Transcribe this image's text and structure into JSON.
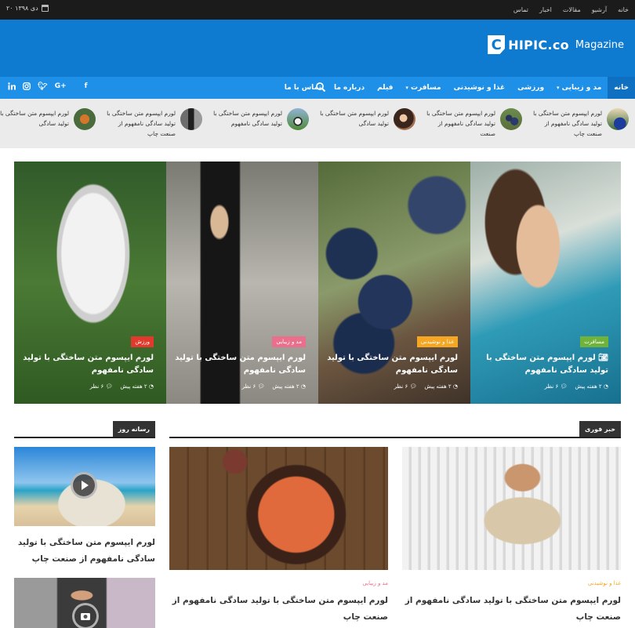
{
  "topbar": {
    "nav": [
      "خانه",
      "آرشیو",
      "مقالات",
      "اخبار",
      "تماس"
    ],
    "date": "۲۰ دی ۱۳۹۸"
  },
  "header": {
    "logo_letter": "C",
    "logo_word": "HIPIC.co",
    "logo_sub": "Magazine"
  },
  "menu": {
    "items": [
      {
        "label": "خانه",
        "active": true,
        "dropdown": false
      },
      {
        "label": "مد و زیبایی",
        "active": false,
        "dropdown": true
      },
      {
        "label": "ورزشی",
        "active": false,
        "dropdown": false
      },
      {
        "label": "غذا و نوشیدنی",
        "active": false,
        "dropdown": false
      },
      {
        "label": "مسافرت",
        "active": false,
        "dropdown": true
      },
      {
        "label": "فیلم",
        "active": false,
        "dropdown": false
      },
      {
        "label": "درباره ما",
        "active": false,
        "dropdown": false
      },
      {
        "label": "تماس با ما",
        "active": false,
        "dropdown": false
      }
    ],
    "dropdown_arrow": "▾",
    "social": [
      "f",
      "t",
      "G+",
      "ig",
      "in"
    ],
    "search_icon": "search-icon"
  },
  "ticker": [
    {
      "title": "لورم ایپسوم متن ساختگی با تولید سادگی نامفهوم از صنعت چاپ"
    },
    {
      "title": "لورم ایپسوم متن ساختگی با تولید سادگی نامفهوم از صنعت"
    },
    {
      "title": "لورم ایپسوم متن ساختگی با تولید سادگی"
    },
    {
      "title": "لورم ایپسوم متن ساختگی با تولید سادگی نامفهوم"
    },
    {
      "title": "لورم ایپسوم متن ساختگی با تولید سادگی نامفهوم از صنعت چاپ"
    },
    {
      "title": "لورم ایپسوم متن ساختگی با تولید سادگی"
    }
  ],
  "slider": [
    {
      "category": "مسافرت",
      "cat_color": "#6fb33a",
      "title": "لورم ایپسوم متن ساختگی با تولید سادگی نامفهوم",
      "time": "۲ هفته پیش",
      "views": "۶ نظر",
      "camera": true
    },
    {
      "category": "غذا و نوشیدنی",
      "cat_color": "#f5a623",
      "title": "لورم ایپسوم متن ساختگی با تولید سادگی نامفهوم",
      "time": "۲ هفته پیش",
      "views": "۶ نظر",
      "camera": false
    },
    {
      "category": "مد و زیبایی",
      "cat_color": "#e96f8c",
      "title": "لورم ایپسوم متن ساختگی با تولید سادگی نامفهوم",
      "time": "۲ هفته پیش",
      "views": "۶ نظر",
      "camera": false
    },
    {
      "category": "ورزش",
      "cat_color": "#e2392d",
      "title": "لورم ایپسوم متن ساختگی با تولید سادگی نامفهوم",
      "time": "۲ هفته پیش",
      "views": "۶ نظر",
      "camera": false
    }
  ],
  "sections": {
    "breaking": "خبر فوری",
    "daily": "رسانه روز"
  },
  "breaking_cards": [
    {
      "category": "غذا و نوشیدنی",
      "cat_color": "#f5a623",
      "title": "لورم ایپسوم متن ساختگی با تولید سادگی نامفهوم از صنعت چاپ"
    },
    {
      "category": "مد و زیبایی",
      "cat_color": "#e96f8c",
      "title": "لورم ایپسوم متن ساختگی با تولید سادگی نامفهوم از صنعت چاپ"
    }
  ],
  "daily_cards": [
    {
      "title": "لورم ایپسوم متن ساختگی با تولید سادگی نامفهوم از صنعت چاپ"
    }
  ]
}
